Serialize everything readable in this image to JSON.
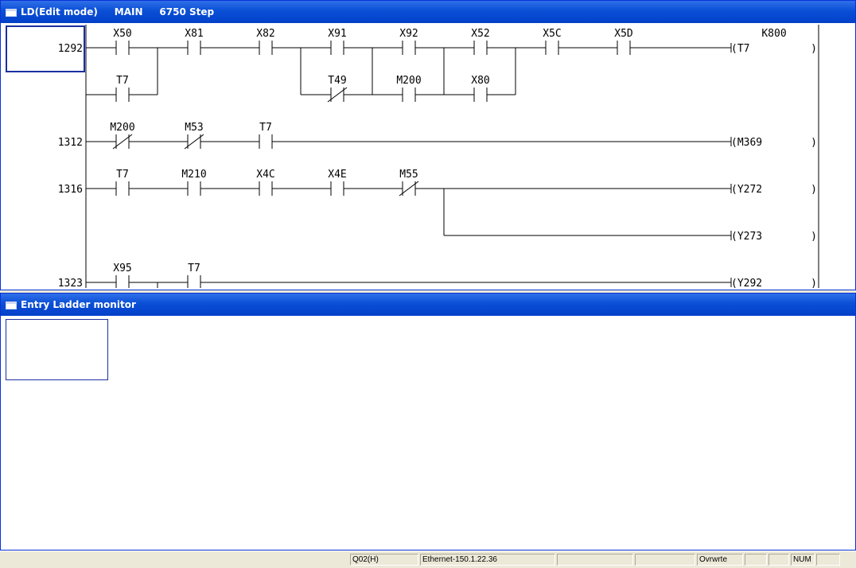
{
  "ladder_window": {
    "title_mode": "LD(Edit mode)",
    "title_program": "MAIN",
    "title_steps": "6750 Step"
  },
  "rungs": [
    {
      "step": "1292",
      "contacts": [
        {
          "label": "X50",
          "type": "NO"
        },
        {
          "label": "X81",
          "type": "NO"
        },
        {
          "label": "X82",
          "type": "NO"
        },
        {
          "label": "X91",
          "type": "NO"
        },
        {
          "label": "X92",
          "type": "NO"
        },
        {
          "label": "X52",
          "type": "NO"
        },
        {
          "label": "X5C",
          "type": "NO"
        },
        {
          "label": "X5D",
          "type": "NO"
        },
        {
          "label": "T7",
          "type": "NO"
        },
        {
          "label": "T49",
          "type": "NC"
        },
        {
          "label": "M200",
          "type": "NO"
        },
        {
          "label": "X80",
          "type": "NO"
        }
      ],
      "coil": "(T7",
      "coil_const": "K800"
    },
    {
      "step": "1312",
      "contacts": [
        {
          "label": "M200",
          "type": "NC"
        },
        {
          "label": "M53",
          "type": "NC"
        },
        {
          "label": "T7",
          "type": "NO"
        }
      ],
      "coil": "(M369"
    },
    {
      "step": "1316",
      "contacts": [
        {
          "label": "T7",
          "type": "NO"
        },
        {
          "label": "M210",
          "type": "NO"
        },
        {
          "label": "X4C",
          "type": "NO"
        },
        {
          "label": "X4E",
          "type": "NO"
        },
        {
          "label": "M55",
          "type": "NC"
        }
      ],
      "coil": "(Y272",
      "coil2": "(Y273"
    },
    {
      "step": "1323",
      "contacts": [
        {
          "label": "X95",
          "type": "NO"
        },
        {
          "label": "T7",
          "type": "NO"
        }
      ],
      "coil": "(Y292"
    }
  ],
  "coil_close": ")",
  "monitor_window": {
    "title": "Entry Ladder monitor"
  },
  "statusbar": {
    "cpu": "Q02(H)",
    "connection": "Ethernet-150.1.22.36",
    "mode": "Ovrwrte",
    "num": "NUM"
  },
  "colors": {
    "title_gradient": "#0a4fd6",
    "cursor_border": "#1c2fa0",
    "status_bg": "#ece9d8"
  }
}
